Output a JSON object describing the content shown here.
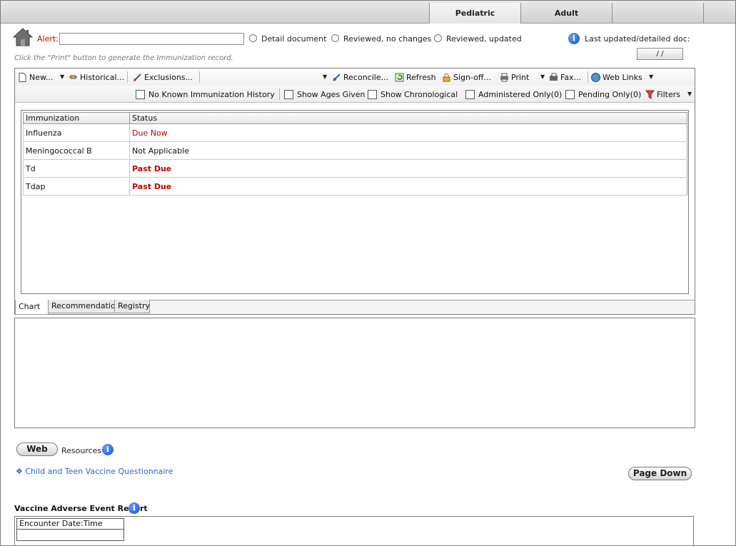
{
  "top_tabs": [
    {
      "label": "Pediatric",
      "active": true
    },
    {
      "label": "Adult",
      "active": false
    },
    {
      "label": "",
      "active": false
    }
  ],
  "header": {
    "alert_label": "Alert:",
    "alert_value": "",
    "radio_options": [
      "Detail document",
      "Reviewed, no changes",
      "Reviewed, updated"
    ],
    "last_updated_label": "Last updated/detailed doc:",
    "last_updated_value": "/ /",
    "hint": "Click the \"Print\" button to generate the Immunization record."
  },
  "toolbar": {
    "new_label": "New...",
    "historical_label": "Historical...",
    "exclusions_label": "Exclusions...",
    "reconcile_label": "Reconcile...",
    "refresh_label": "Refresh",
    "signoff_label": "Sign-off...",
    "print_label": "Print",
    "fax_label": "Fax...",
    "weblinks_label": "Web Links",
    "filters_label": "Filters"
  },
  "filters": {
    "no_history": "No Known Immunization History",
    "show_ages": "Show Ages Given",
    "show_chrono": "Show Chronological",
    "administered_only": "Administered Only(0)",
    "pending_only": "Pending Only(0)"
  },
  "grid": {
    "columns": [
      "Immunization",
      "Status"
    ],
    "rows": [
      {
        "name": "Influenza",
        "status": "Due Now",
        "style": "red"
      },
      {
        "name": "Meningococcal B",
        "status": "Not Applicable",
        "style": "normal"
      },
      {
        "name": "Td",
        "status": "Past Due",
        "style": "red-bold"
      },
      {
        "name": "Tdap",
        "status": "Past Due",
        "style": "red-bold"
      }
    ]
  },
  "bottom_tabs": [
    "Chart",
    "Recommendation",
    "Registry"
  ],
  "resources": {
    "web_button": "Web",
    "label": "Resources",
    "link": "Child and Teen Vaccine Questionnaire",
    "page_down": "Page Down"
  },
  "vaers": {
    "title": "Vaccine Adverse Event Report",
    "column": "Encounter Date:Time"
  },
  "colors": {
    "alert_red": "#c00000",
    "link_blue": "#2a66c8",
    "info_blue": "#1d4fb6"
  }
}
